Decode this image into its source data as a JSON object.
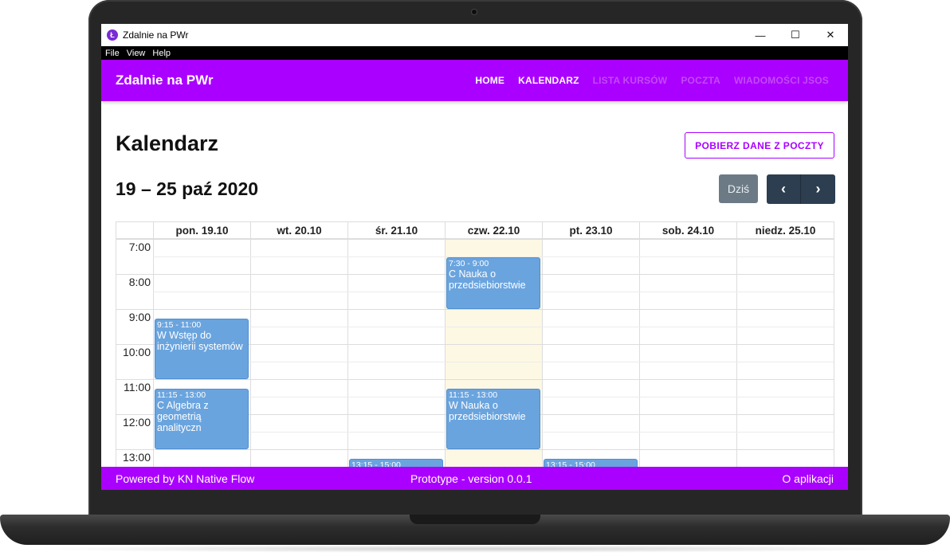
{
  "window": {
    "title": "Zdalnie na PWr",
    "minimize": "—",
    "maximize": "☐",
    "close": "✕"
  },
  "menu": [
    "File",
    "View",
    "Help"
  ],
  "navbar": {
    "brand": "Zdalnie na PWr",
    "links": [
      "HOME",
      "KALENDARZ",
      "LISTA KURSÓW",
      "POCZTA",
      "WIADOMOŚCI JSOS"
    ]
  },
  "page": {
    "title": "Kalendarz",
    "mail_button": "POBIERZ DANE Z POCZTY",
    "range": "19 – 25 paź 2020",
    "today_button": "Dziś",
    "prev_icon": "‹",
    "next_icon": "›"
  },
  "calendar": {
    "days": [
      "pon. 19.10",
      "wt. 20.10",
      "śr. 21.10",
      "czw. 22.10",
      "pt. 23.10",
      "sob. 24.10",
      "niedz. 25.10"
    ],
    "today_index": 3,
    "hours": [
      "7:00",
      "8:00",
      "9:00",
      "10:00",
      "11:00",
      "12:00",
      "13:00"
    ],
    "events": [
      {
        "day": 0,
        "start": "9:15",
        "end": "11:00",
        "time": "9:15 - 11:00",
        "title": "W Wstęp do inżynierii systemów"
      },
      {
        "day": 0,
        "start": "11:15",
        "end": "13:00",
        "time": "11:15 - 13:00",
        "title": "C Algebra z geometrią analityczn"
      },
      {
        "day": 3,
        "start": "7:30",
        "end": "9:00",
        "time": "7:30 - 9:00",
        "title": "C Nauka o przedsiebiorstwie"
      },
      {
        "day": 3,
        "start": "11:15",
        "end": "13:00",
        "time": "11:15 - 13:00",
        "title": "W Nauka o przedsiebiorstwie"
      },
      {
        "day": 2,
        "start": "13:15",
        "end": "15:00",
        "time": "13:15 - 15:00",
        "title": ""
      },
      {
        "day": 4,
        "start": "13:15",
        "end": "15:00",
        "time": "13:15 - 15:00",
        "title": ""
      }
    ],
    "event_color": "#6aa4de",
    "today_color": "#fcf8e3"
  },
  "footer": {
    "left": "Powered by KN Native Flow",
    "center": "Prototype - version 0.0.1",
    "right": "O aplikacji"
  },
  "colors": {
    "accent": "#aa00ff",
    "nav_dark": "#2c3e50",
    "today_button": "#6c7a86"
  }
}
